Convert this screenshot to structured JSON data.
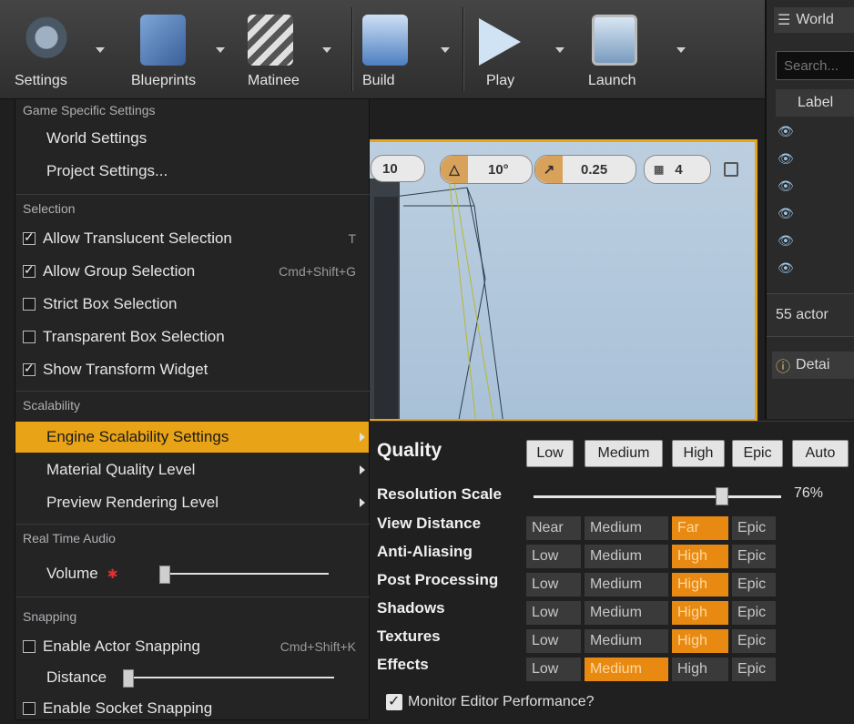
{
  "toolbar": {
    "buttons": [
      {
        "label": "Settings"
      },
      {
        "label": "Blueprints"
      },
      {
        "label": "Matinee"
      },
      {
        "label": "Build"
      },
      {
        "label": "Play"
      },
      {
        "label": "Launch"
      }
    ]
  },
  "viewport": {
    "grid_value": "10",
    "rotation_value": "10°",
    "scale_value": "0.25",
    "camera_speed": "4"
  },
  "outliner": {
    "title": "World",
    "search_placeholder": "Search...",
    "column_label": "Label",
    "actor_count": "55 actor",
    "details_tab": "Detai"
  },
  "menu": {
    "sections": {
      "game": "Game Specific Settings",
      "selection": "Selection",
      "scalability": "Scalability",
      "audio": "Real Time Audio",
      "snapping": "Snapping"
    },
    "items": {
      "world_settings": "World Settings",
      "project_settings": "Project Settings...",
      "translucent": "Allow Translucent Selection",
      "translucent_key": "T",
      "group": "Allow Group Selection",
      "group_key": "Cmd+Shift+G",
      "strict_box": "Strict Box Selection",
      "transparent_box": "Transparent Box Selection",
      "transform_widget": "Show Transform Widget",
      "engine_scal": "Engine Scalability Settings",
      "material_quality": "Material Quality Level",
      "preview_rendering": "Preview Rendering Level",
      "volume": "Volume",
      "actor_snapping": "Enable Actor Snapping",
      "actor_snapping_key": "Cmd+Shift+K",
      "distance": "Distance",
      "socket_snapping": "Enable Socket Snapping"
    },
    "checks": {
      "translucent": true,
      "group": true,
      "strict_box": false,
      "transparent_box": false,
      "transform_widget": true,
      "actor_snapping": false,
      "socket_snapping": false
    },
    "volume_level": 0.0,
    "distance_level": 0.0
  },
  "scalability": {
    "title": "Quality",
    "presets": [
      "Low",
      "Medium",
      "High",
      "Epic",
      "Auto"
    ],
    "resolution_label": "Resolution Scale",
    "resolution_value": "76%",
    "resolution_fraction": 0.76,
    "rows": [
      {
        "label": "View Distance",
        "options": [
          "Near",
          "Medium",
          "Far",
          "Epic"
        ],
        "selected": 2
      },
      {
        "label": "Anti-Aliasing",
        "options": [
          "Low",
          "Medium",
          "High",
          "Epic"
        ],
        "selected": 2
      },
      {
        "label": "Post Processing",
        "options": [
          "Low",
          "Medium",
          "High",
          "Epic"
        ],
        "selected": 2
      },
      {
        "label": "Shadows",
        "options": [
          "Low",
          "Medium",
          "High",
          "Epic"
        ],
        "selected": 2
      },
      {
        "label": "Textures",
        "options": [
          "Low",
          "Medium",
          "High",
          "Epic"
        ],
        "selected": 2
      },
      {
        "label": "Effects",
        "options": [
          "Low",
          "Medium",
          "High",
          "Epic"
        ],
        "selected": 1
      }
    ],
    "monitor_label": "Monitor Editor Performance?",
    "monitor_checked": true
  }
}
